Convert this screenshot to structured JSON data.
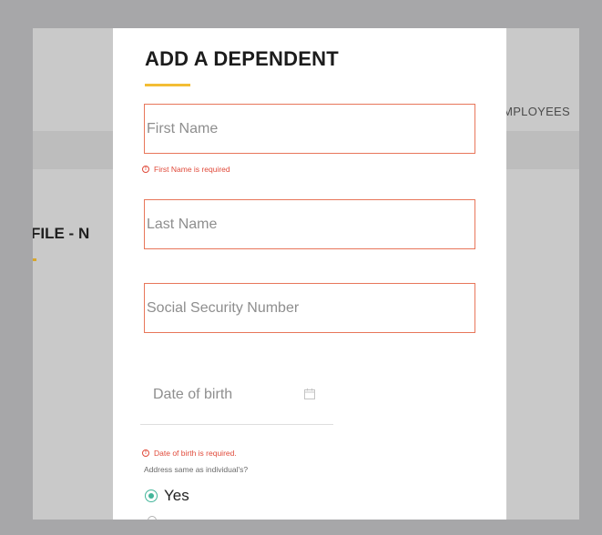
{
  "background": {
    "nav_item": "MPLOYEES",
    "heading": "FILE - N"
  },
  "modal": {
    "title": "ADD A DEPENDENT",
    "first_name": {
      "value": "",
      "placeholder": "First Name",
      "error": "First Name is required"
    },
    "last_name": {
      "value": "",
      "placeholder": "Last Name"
    },
    "ssn": {
      "value": "",
      "placeholder": "Social Security Number"
    },
    "dob": {
      "value": "",
      "placeholder": "Date of birth",
      "error": "Date of birth is required.",
      "icon": "calendar-icon"
    },
    "address_question": "Address same as individual's?",
    "address_options": [
      {
        "label": "Yes",
        "selected": true
      }
    ]
  },
  "colors": {
    "accent_yellow": "#f3bd34",
    "error_red": "#e04a3a",
    "field_border": "#e8765a",
    "radio_green": "#43b59a",
    "overlay": "#a7a7a9"
  }
}
